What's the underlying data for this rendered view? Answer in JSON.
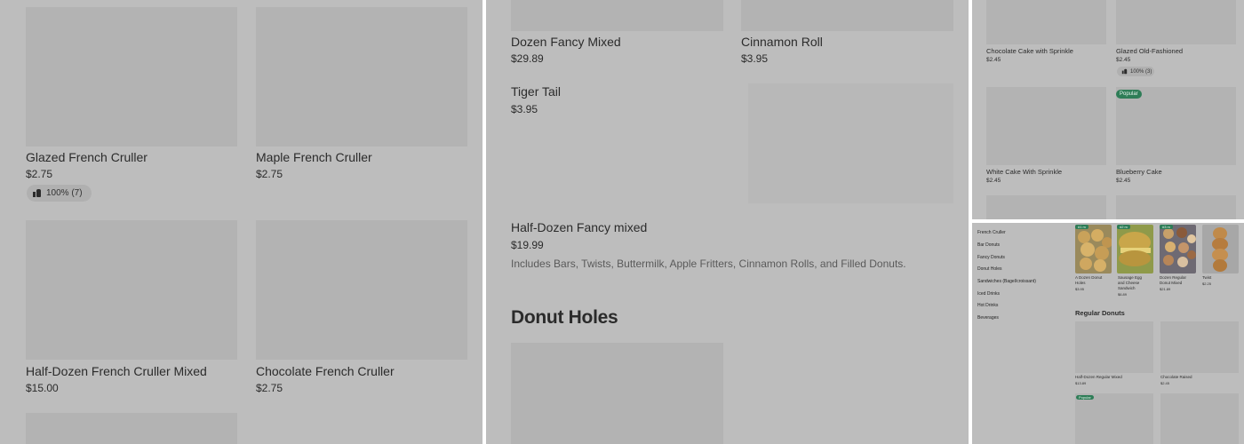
{
  "panel1": {
    "items": [
      {
        "name": "Glazed French Cruller",
        "price": "$2.75",
        "rating": "100% (7)"
      },
      {
        "name": "Maple French Cruller",
        "price": "$2.75"
      },
      {
        "name": "Half-Dozen French Cruller Mixed",
        "price": "$15.00"
      },
      {
        "name": "Chocolate French Cruller",
        "price": "$2.75"
      }
    ]
  },
  "panel2": {
    "items": [
      {
        "name": "Dozen Fancy Mixed",
        "price": "$29.89"
      },
      {
        "name": "Cinnamon Roll",
        "price": "$3.95"
      },
      {
        "name": "Tiger Tail",
        "price": "$3.95"
      },
      {
        "name": "Half-Dozen Fancy mixed",
        "price": "$19.99",
        "description": "Includes Bars, Twists, Buttermilk, Apple Fritters, Cinnamon Rolls, and Filled Donuts."
      }
    ],
    "section_title": "Donut Holes"
  },
  "panel3": {
    "items": [
      {
        "name": "Chocolate Cake with Sprinkle",
        "price": "$2.45"
      },
      {
        "name": "Glazed Old-Fashioned",
        "price": "$2.45",
        "rating": "100% (3)"
      },
      {
        "name": "White Cake With Sprinkle",
        "price": "$2.45"
      },
      {
        "name": "Blueberry Cake",
        "price": "$2.45",
        "badge": "Popular"
      }
    ]
  },
  "panel4": {
    "nav": [
      "French Cruller",
      "Bar Donuts",
      "Fancy Donuts",
      "Donut Holes",
      "Sandwiches (Bagel/croissant)",
      "Iced Drinks",
      "Hot Drinks",
      "Beverages"
    ],
    "featured": [
      {
        "badge": "#1 m",
        "name_lines": [
          "A Dozen Donut",
          "Holes"
        ],
        "price": "$3.95"
      },
      {
        "badge": "#2 m",
        "name_lines": [
          "Sausage Egg",
          "and Cheese",
          "Sandwich"
        ],
        "price": "$6.89"
      },
      {
        "badge": "#3 m",
        "name_lines": [
          "Dozen Regular",
          "Donut Mixed"
        ],
        "price": "$21.89"
      },
      {
        "name_lines": [
          "Twist"
        ],
        "price": "$2.25"
      }
    ],
    "section_title": "Regular Donuts",
    "items": [
      {
        "name": "Half-Dozen Regular Mixed",
        "price": "$13.89"
      },
      {
        "name": "Chocolate Raised",
        "price": "$2.45"
      }
    ],
    "popular_badge": "Popular"
  },
  "colors": {
    "overlay": "#bdbdbd",
    "placeholder": "#b3b3b3",
    "popular": "#2e7d57"
  }
}
